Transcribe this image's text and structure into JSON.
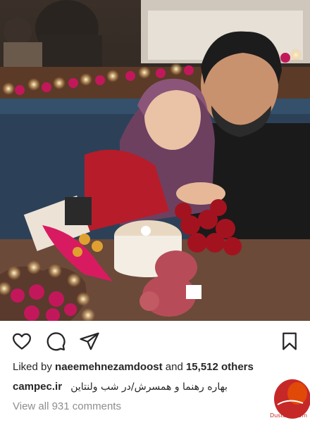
{
  "post": {
    "likes_prefix": "Liked by",
    "liked_by_user": "naeemehnezamdoost",
    "likes_joiner": "and",
    "likes_count": "15,512 others",
    "caption_user": "campec.ir",
    "caption_text": "بهاره رهنما و همسرش/در شب ولنتاین",
    "comments_link": "View all 931 comments"
  },
  "icons": {
    "like": "heart-icon",
    "comment": "comment-bubble-icon",
    "share": "paper-plane-icon",
    "save": "bookmark-icon"
  },
  "watermark": {
    "site": "Dustaan.com",
    "logo_text": "مجله دوستان"
  },
  "colors": {
    "text": "#262626",
    "muted": "#8e8e8e",
    "watermark": "#c62828"
  }
}
